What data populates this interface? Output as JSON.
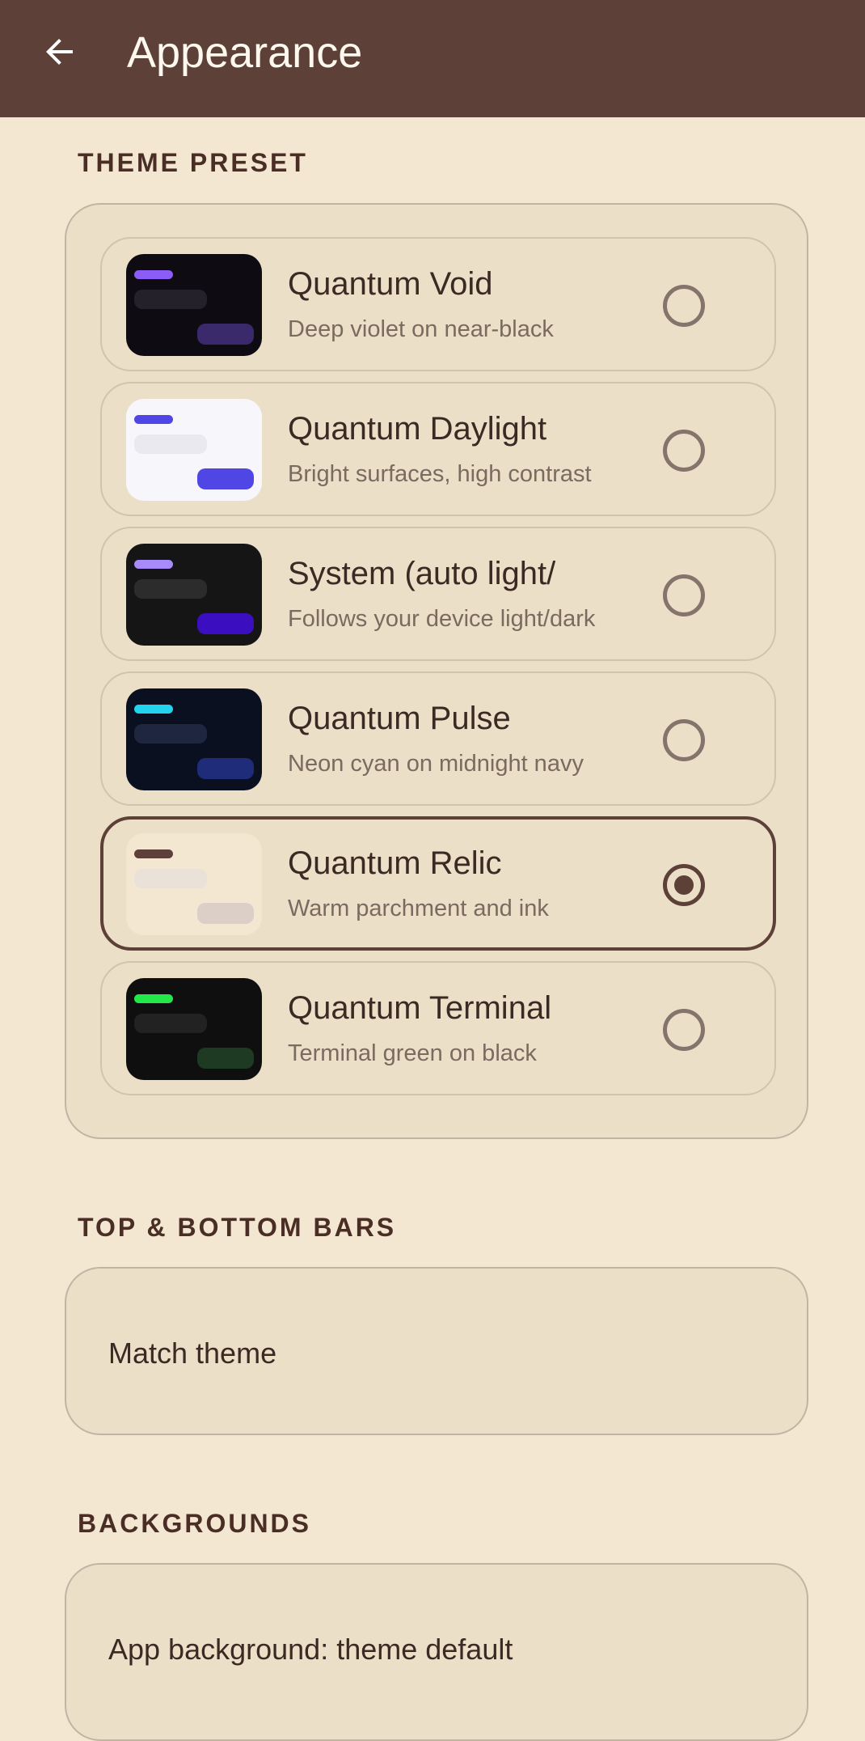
{
  "app_bar": {
    "title": "Appearance",
    "back_icon": "arrow-back-icon",
    "background": "#5D4037"
  },
  "sections": {
    "theme_preset": {
      "label": "THEME PRESET",
      "selected_index": 4,
      "items": [
        {
          "name": "Quantum Void",
          "description": "Deep violet on near-black",
          "selected": false,
          "preview": {
            "bg": "#0E0B12",
            "accent": "#8B5CF6",
            "bar": "#24212B",
            "pill": "#3A2A6B"
          }
        },
        {
          "name": "Quantum Daylight",
          "description": "Bright surfaces, high contrast",
          "selected": false,
          "preview": {
            "bg": "#F6F6FB",
            "accent": "#4F46E5",
            "bar": "#E9E9EF",
            "pill": "#4F46E5"
          }
        },
        {
          "name": "System (auto light/",
          "description": "Follows your device light/dark",
          "selected": false,
          "preview": {
            "bg": "#151515",
            "accent": "#A78BFA",
            "bar": "#2C2C2C",
            "pill": "#3B0FC0"
          }
        },
        {
          "name": "Quantum Pulse",
          "description": "Neon cyan on midnight navy",
          "selected": false,
          "preview": {
            "bg": "#0B1020",
            "accent": "#22D3EE",
            "bar": "#1F2740",
            "pill": "#1E2C7A"
          }
        },
        {
          "name": "Quantum Relic",
          "description": "Warm parchment and ink",
          "selected": true,
          "preview": {
            "bg": "#F3E7D1",
            "accent": "#5D4037",
            "bar": "#EAE2D8",
            "pill": "#DCCFC8"
          }
        },
        {
          "name": "Quantum Terminal",
          "description": "Terminal green on black",
          "selected": false,
          "preview": {
            "bg": "#0F0F0F",
            "accent": "#22E84A",
            "bar": "#222222",
            "pill": "#1E3A22"
          }
        }
      ]
    },
    "bars": {
      "label": "TOP & BOTTOM BARS",
      "value": "Match theme"
    },
    "backgrounds": {
      "label": "BACKGROUNDS",
      "value": "App background: theme default"
    }
  },
  "colors": {
    "page_bg": "#F3E7D1",
    "card_bg": "#ECDFC8",
    "accent": "#5D4037"
  }
}
